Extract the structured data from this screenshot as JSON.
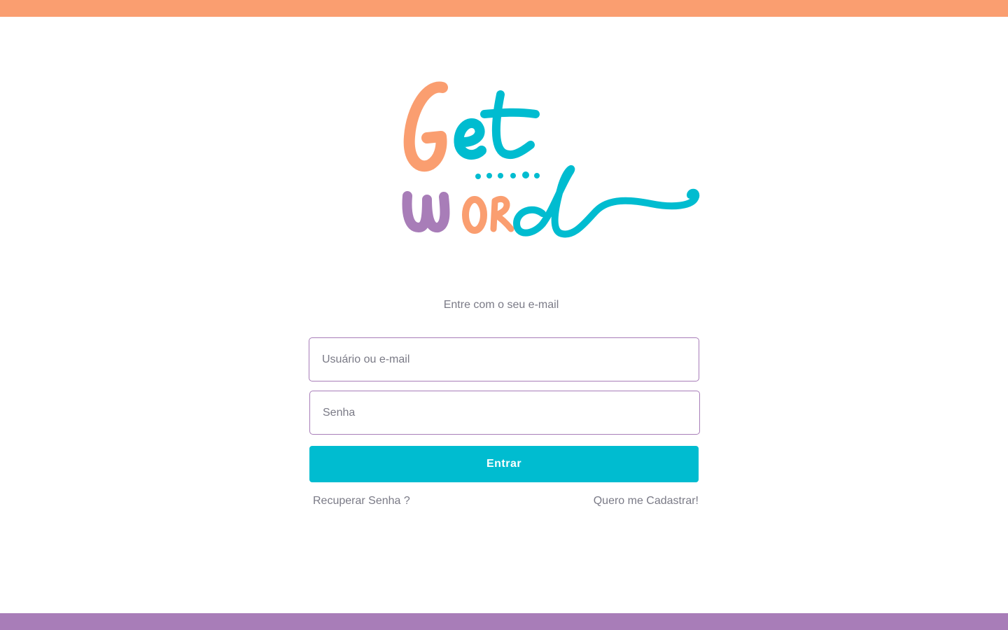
{
  "colors": {
    "top_bar": "#FA9E70",
    "bottom_bar": "#A87DB8",
    "accent": "#00BCD0",
    "field_border": "#A87DB8",
    "text_muted": "#7A7A86"
  },
  "logo": {
    "text": "Get word",
    "icon": "getword-logo"
  },
  "login": {
    "subtitle": "Entre com o seu e-mail",
    "username_placeholder": "Usuário ou e-mail",
    "password_placeholder": "Senha",
    "submit_label": "Entrar",
    "recover_label": "Recuperar Senha ?",
    "signup_label": "Quero me Cadastrar!"
  }
}
